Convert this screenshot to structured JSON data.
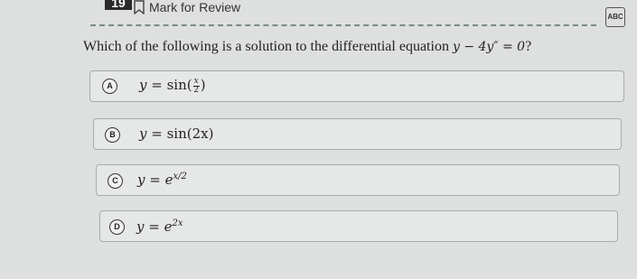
{
  "header": {
    "question_number": "19",
    "mark_label": "Mark for Review",
    "tool_label": "ABC"
  },
  "question": {
    "text": "Which of the following is a solution to the differential equation",
    "equation": "y − 4y″ = 0",
    "end": "?"
  },
  "options": [
    {
      "letter": "A",
      "lhs": "y",
      "rhs_fn": "sin",
      "frac_num": "x",
      "frac_den": "2"
    },
    {
      "letter": "B",
      "lhs": "y",
      "rhs": "sin(2x)"
    },
    {
      "letter": "C",
      "lhs": "y",
      "base": "e",
      "exp": "x/2"
    },
    {
      "letter": "D",
      "lhs": "y",
      "base": "e",
      "exp": "2x"
    }
  ]
}
